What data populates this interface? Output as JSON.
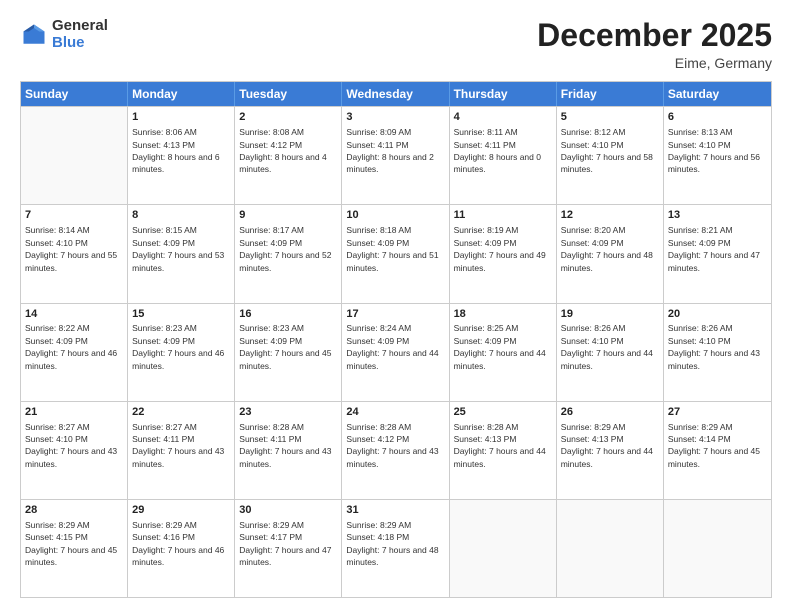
{
  "logo": {
    "general": "General",
    "blue": "Blue"
  },
  "title": "December 2025",
  "location": "Eime, Germany",
  "header_days": [
    "Sunday",
    "Monday",
    "Tuesday",
    "Wednesday",
    "Thursday",
    "Friday",
    "Saturday"
  ],
  "weeks": [
    [
      {
        "day": "",
        "empty": true
      },
      {
        "day": "1",
        "sunrise": "Sunrise: 8:06 AM",
        "sunset": "Sunset: 4:13 PM",
        "daylight": "Daylight: 8 hours and 6 minutes."
      },
      {
        "day": "2",
        "sunrise": "Sunrise: 8:08 AM",
        "sunset": "Sunset: 4:12 PM",
        "daylight": "Daylight: 8 hours and 4 minutes."
      },
      {
        "day": "3",
        "sunrise": "Sunrise: 8:09 AM",
        "sunset": "Sunset: 4:11 PM",
        "daylight": "Daylight: 8 hours and 2 minutes."
      },
      {
        "day": "4",
        "sunrise": "Sunrise: 8:11 AM",
        "sunset": "Sunset: 4:11 PM",
        "daylight": "Daylight: 8 hours and 0 minutes."
      },
      {
        "day": "5",
        "sunrise": "Sunrise: 8:12 AM",
        "sunset": "Sunset: 4:10 PM",
        "daylight": "Daylight: 7 hours and 58 minutes."
      },
      {
        "day": "6",
        "sunrise": "Sunrise: 8:13 AM",
        "sunset": "Sunset: 4:10 PM",
        "daylight": "Daylight: 7 hours and 56 minutes."
      }
    ],
    [
      {
        "day": "7",
        "sunrise": "Sunrise: 8:14 AM",
        "sunset": "Sunset: 4:10 PM",
        "daylight": "Daylight: 7 hours and 55 minutes."
      },
      {
        "day": "8",
        "sunrise": "Sunrise: 8:15 AM",
        "sunset": "Sunset: 4:09 PM",
        "daylight": "Daylight: 7 hours and 53 minutes."
      },
      {
        "day": "9",
        "sunrise": "Sunrise: 8:17 AM",
        "sunset": "Sunset: 4:09 PM",
        "daylight": "Daylight: 7 hours and 52 minutes."
      },
      {
        "day": "10",
        "sunrise": "Sunrise: 8:18 AM",
        "sunset": "Sunset: 4:09 PM",
        "daylight": "Daylight: 7 hours and 51 minutes."
      },
      {
        "day": "11",
        "sunrise": "Sunrise: 8:19 AM",
        "sunset": "Sunset: 4:09 PM",
        "daylight": "Daylight: 7 hours and 49 minutes."
      },
      {
        "day": "12",
        "sunrise": "Sunrise: 8:20 AM",
        "sunset": "Sunset: 4:09 PM",
        "daylight": "Daylight: 7 hours and 48 minutes."
      },
      {
        "day": "13",
        "sunrise": "Sunrise: 8:21 AM",
        "sunset": "Sunset: 4:09 PM",
        "daylight": "Daylight: 7 hours and 47 minutes."
      }
    ],
    [
      {
        "day": "14",
        "sunrise": "Sunrise: 8:22 AM",
        "sunset": "Sunset: 4:09 PM",
        "daylight": "Daylight: 7 hours and 46 minutes."
      },
      {
        "day": "15",
        "sunrise": "Sunrise: 8:23 AM",
        "sunset": "Sunset: 4:09 PM",
        "daylight": "Daylight: 7 hours and 46 minutes."
      },
      {
        "day": "16",
        "sunrise": "Sunrise: 8:23 AM",
        "sunset": "Sunset: 4:09 PM",
        "daylight": "Daylight: 7 hours and 45 minutes."
      },
      {
        "day": "17",
        "sunrise": "Sunrise: 8:24 AM",
        "sunset": "Sunset: 4:09 PM",
        "daylight": "Daylight: 7 hours and 44 minutes."
      },
      {
        "day": "18",
        "sunrise": "Sunrise: 8:25 AM",
        "sunset": "Sunset: 4:09 PM",
        "daylight": "Daylight: 7 hours and 44 minutes."
      },
      {
        "day": "19",
        "sunrise": "Sunrise: 8:26 AM",
        "sunset": "Sunset: 4:10 PM",
        "daylight": "Daylight: 7 hours and 44 minutes."
      },
      {
        "day": "20",
        "sunrise": "Sunrise: 8:26 AM",
        "sunset": "Sunset: 4:10 PM",
        "daylight": "Daylight: 7 hours and 43 minutes."
      }
    ],
    [
      {
        "day": "21",
        "sunrise": "Sunrise: 8:27 AM",
        "sunset": "Sunset: 4:10 PM",
        "daylight": "Daylight: 7 hours and 43 minutes."
      },
      {
        "day": "22",
        "sunrise": "Sunrise: 8:27 AM",
        "sunset": "Sunset: 4:11 PM",
        "daylight": "Daylight: 7 hours and 43 minutes."
      },
      {
        "day": "23",
        "sunrise": "Sunrise: 8:28 AM",
        "sunset": "Sunset: 4:11 PM",
        "daylight": "Daylight: 7 hours and 43 minutes."
      },
      {
        "day": "24",
        "sunrise": "Sunrise: 8:28 AM",
        "sunset": "Sunset: 4:12 PM",
        "daylight": "Daylight: 7 hours and 43 minutes."
      },
      {
        "day": "25",
        "sunrise": "Sunrise: 8:28 AM",
        "sunset": "Sunset: 4:13 PM",
        "daylight": "Daylight: 7 hours and 44 minutes."
      },
      {
        "day": "26",
        "sunrise": "Sunrise: 8:29 AM",
        "sunset": "Sunset: 4:13 PM",
        "daylight": "Daylight: 7 hours and 44 minutes."
      },
      {
        "day": "27",
        "sunrise": "Sunrise: 8:29 AM",
        "sunset": "Sunset: 4:14 PM",
        "daylight": "Daylight: 7 hours and 45 minutes."
      }
    ],
    [
      {
        "day": "28",
        "sunrise": "Sunrise: 8:29 AM",
        "sunset": "Sunset: 4:15 PM",
        "daylight": "Daylight: 7 hours and 45 minutes."
      },
      {
        "day": "29",
        "sunrise": "Sunrise: 8:29 AM",
        "sunset": "Sunset: 4:16 PM",
        "daylight": "Daylight: 7 hours and 46 minutes."
      },
      {
        "day": "30",
        "sunrise": "Sunrise: 8:29 AM",
        "sunset": "Sunset: 4:17 PM",
        "daylight": "Daylight: 7 hours and 47 minutes."
      },
      {
        "day": "31",
        "sunrise": "Sunrise: 8:29 AM",
        "sunset": "Sunset: 4:18 PM",
        "daylight": "Daylight: 7 hours and 48 minutes."
      },
      {
        "day": "",
        "empty": true
      },
      {
        "day": "",
        "empty": true
      },
      {
        "day": "",
        "empty": true
      }
    ]
  ]
}
